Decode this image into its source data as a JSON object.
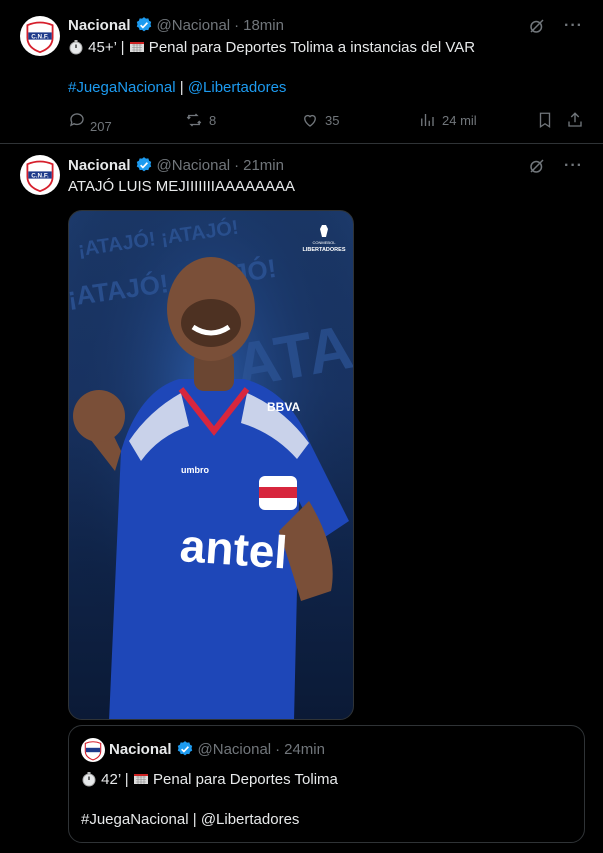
{
  "colors": {
    "background": "#000000",
    "text": "#e7e9ea",
    "muted": "#71767b",
    "link": "#1d9bf0",
    "border": "#2f3336",
    "verified": "#1d9bf0"
  },
  "tweets": [
    {
      "name": "Nacional",
      "handle": "@Nacional",
      "separator": "·",
      "time": "18min",
      "line1": "45+' | 🥅 Penal para Deportes Tolima a instancias del VAR",
      "line1_parts": {
        "stopwatch_icon": "stopwatch-icon",
        "minute": "45+’",
        "rest": " | ",
        "goal_icon": "goal-net-icon",
        "text": " Penal para Deportes Tolima a instancias del VAR"
      },
      "hashtag": "#JuegaNacional",
      "pipe": " | ",
      "mention": "@Libertadores",
      "stats": {
        "replies": "207",
        "retweets": "8",
        "likes": "35",
        "views": "24 mil"
      }
    },
    {
      "name": "Nacional",
      "handle": "@Nacional",
      "separator": "·",
      "time": "21min",
      "text": "ATAJÓ LUIS MEJIIIIIIIAAAAAAAA",
      "media": {
        "brand_top": "CONMEBOL",
        "brand_bottom": "LIBERTADORES",
        "bg_text": [
          "¡ATAJÓ! ¡ATAJÓ!",
          "¡ATAJÓ! ¡ATAJÓ!",
          "¡ATAJÓ!"
        ],
        "shirt_sponsor": "antel",
        "shirt_brand": "umbro",
        "shirt_sleeve": "BBVA"
      },
      "quote": {
        "name": "Nacional",
        "handle": "@Nacional",
        "separator": "·",
        "time": "24min",
        "minute": "42’",
        "pipe": " | ",
        "text": " Penal para Deportes Tolima",
        "hashtag": "#JuegaNacional",
        "mention": "@Libertadores"
      }
    }
  ]
}
